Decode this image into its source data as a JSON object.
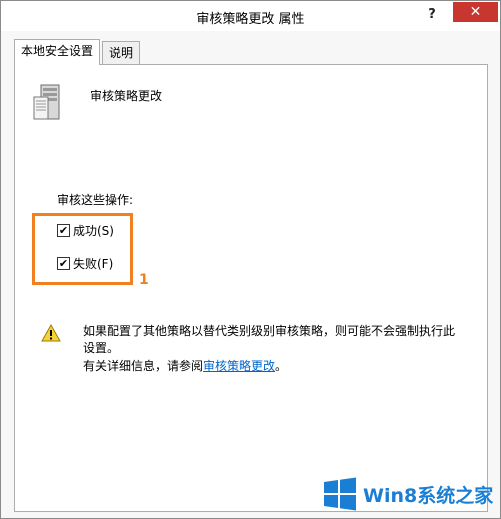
{
  "window": {
    "title": "审核策略更改 属性",
    "help_label": "?",
    "close_label": "✕"
  },
  "tabs": [
    {
      "label": "本地安全设置",
      "active": true
    },
    {
      "label": "说明",
      "active": false
    }
  ],
  "policy": {
    "icon": "server-icon",
    "name": "审核策略更改"
  },
  "audit": {
    "label": "审核这些操作:",
    "options": [
      {
        "label": "成功(S)",
        "checked": true
      },
      {
        "label": "失败(F)",
        "checked": true
      }
    ]
  },
  "annotation": {
    "number": "1",
    "color": "#f08020"
  },
  "warning": {
    "icon": "warning-icon",
    "line1": "如果配置了其他策略以替代类别级别审核策略，则可能不会强制执行此设置。",
    "line2_prefix": "有关详细信息，请参阅",
    "link_text": "审核策略更改",
    "line2_suffix": "。"
  },
  "watermark": {
    "text": "Win8系统之家",
    "icon": "windows-logo-icon",
    "color": "#1a7fd4"
  }
}
